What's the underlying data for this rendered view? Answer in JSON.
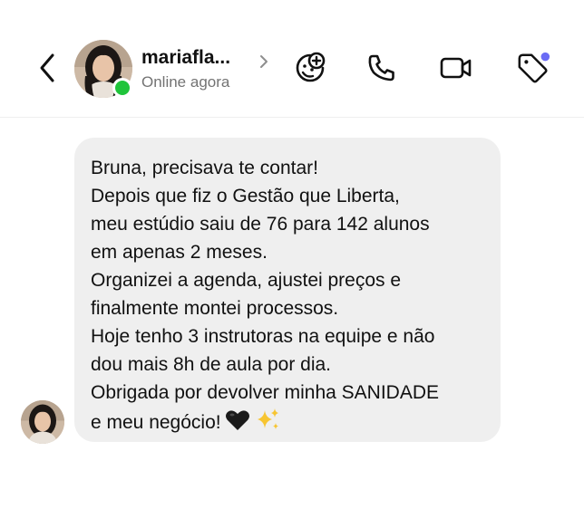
{
  "header": {
    "contact_name": "mariafla...",
    "status": "Online agora",
    "icons": [
      "back-chevron-icon",
      "profile-chevron-icon",
      "face-plus-icon",
      "phone-icon",
      "video-icon",
      "tag-icon"
    ],
    "online_color": "#1fc43a",
    "notification_dot_color": "#6b6cf5"
  },
  "message": {
    "lines": [
      "Bruna, precisava te contar!",
      "Depois que fiz o Gestão que Liberta,",
      "meu estúdio saiu de 76 para 142 alunos",
      "em apenas 2 meses.",
      "Organizei a agenda, ajustei preços e",
      "finalmente montei processos.",
      "Hoje tenho 3 instrutoras na equipe e não",
      "dou mais 8h de aula por dia.",
      "Obrigada por devolver minha SANIDADE",
      "e meu negócio!"
    ],
    "trailing_emojis": [
      "black-heart-icon",
      "sparkles-icon"
    ],
    "bubble_color": "#efefef"
  }
}
